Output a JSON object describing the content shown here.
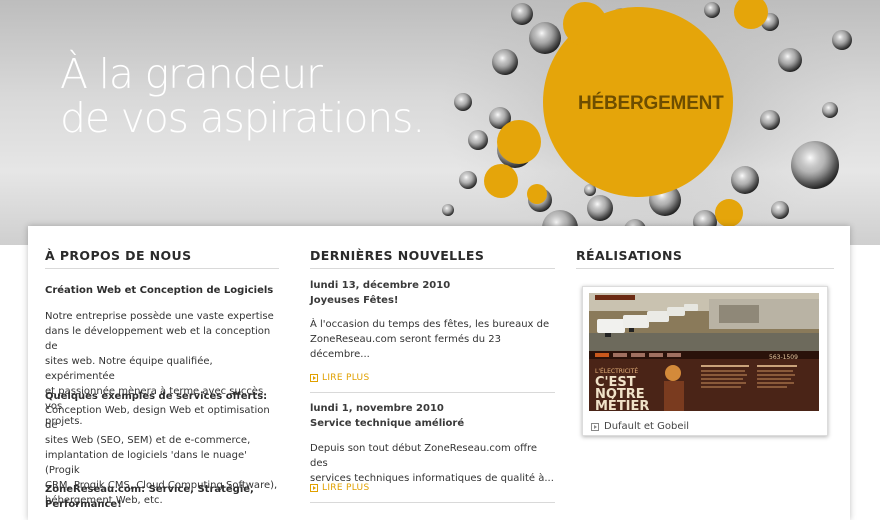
{
  "hero": {
    "tagline_line1": "À la grandeur",
    "tagline_line2": "de vos aspirations.",
    "service_label": "HÉBERGEMENT",
    "accent_color": "#e5a50a"
  },
  "about": {
    "title": "À PROPOS DE NOUS",
    "subtitle": "Création Web et Conception de Logiciels",
    "intro_lines": [
      "Notre entreprise possède une vaste expertise",
      "dans le développement web et la conception de",
      "sites web. Notre équipe qualifiée, expérimentée",
      "et passionnée mènera à terme avec succès vos",
      "projets."
    ],
    "services_heading": "Quelques exemples de services offerts:",
    "services_lines": [
      "Conception Web, design Web et optimisation de",
      "sites Web (SEO, SEM) et de e-commerce,",
      "implantation de logiciels 'dans le nuage' (Progik",
      "CRM, Progik CMS, Cloud Computing Software),",
      "hébergement Web, etc."
    ],
    "closing_lines": [
      "ZoneReseau.com: Service, Stratégie,",
      "Performance!"
    ]
  },
  "news": {
    "title": "DERNIÈRES NOUVELLES",
    "read_more_label": "LIRE PLUS",
    "items": [
      {
        "date": "lundi 13, décembre 2010",
        "headline": "Joyeuses Fêtes!",
        "excerpt_lines": [
          "À l'occasion du temps des fêtes, les bureaux de",
          "ZoneReseau.com seront fermés du 23",
          "décembre..."
        ]
      },
      {
        "date": "lundi 1, novembre 2010",
        "headline": "Service technique amélioré",
        "excerpt_lines": [
          "Depuis son tout début ZoneReseau.com offre des",
          "services techniques informatiques de qualité à..."
        ]
      }
    ]
  },
  "realisations": {
    "title": "RÉALISATIONS",
    "project_caption": "Dufault et Gobeil",
    "thumbnail": {
      "headline_line1": "C'EST",
      "headline_line2": "NOTRE",
      "headline_line3": "MÉTIER",
      "small_label": "L'ÉLECTRICITÉ",
      "phone_fragment": "563-1509"
    }
  }
}
